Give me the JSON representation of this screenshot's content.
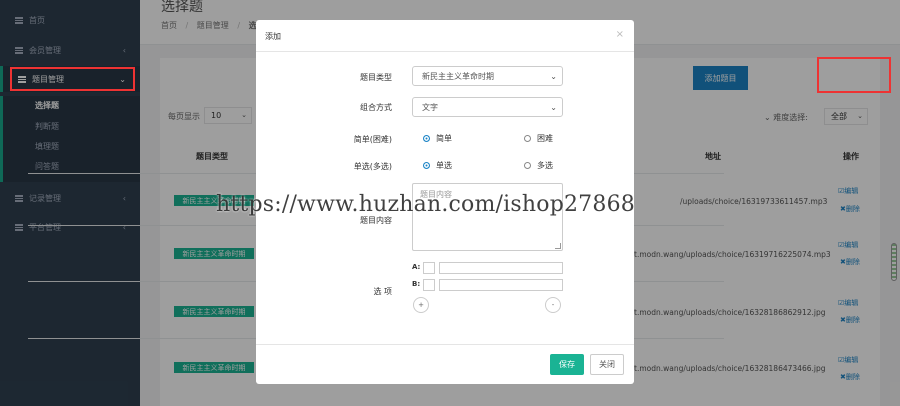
{
  "sidebar": {
    "items": [
      {
        "label": "首页"
      },
      {
        "label": "会员管理"
      },
      {
        "label": "题目管理"
      },
      {
        "label": "记录管理"
      },
      {
        "label": "平台管理"
      }
    ],
    "submenu": [
      "选择题",
      "判断题",
      "填理题",
      "问答题"
    ]
  },
  "header": {
    "title": "选择题",
    "breadcrumb": [
      "首页",
      "题目管理",
      "选"
    ]
  },
  "toolbar": {
    "page_size_label": "每页显示",
    "page_size_value": "10",
    "add_button": "添加题目",
    "difficulty_label": "难度选择:",
    "difficulty_value": "全部"
  },
  "table": {
    "columns": [
      "题目类型",
      "地址",
      "操作"
    ],
    "rows": [
      {
        "type": "新民主主义革命时期",
        "url": "/uploads/choice/16319733611457.mp3"
      },
      {
        "type": "新民主主义革命时期",
        "url": "t.modn.wang/uploads/choice/16319716225074.mp3"
      },
      {
        "type": "新民主主义革命时期",
        "url": "t.modn.wang/uploads/choice/16328186862912.jpg"
      },
      {
        "type": "新民主主义革命时期",
        "url": "t.modn.wang/uploads/choice/16328186473466.jpg"
      }
    ],
    "edit_label": "编辑",
    "delete_label": "删除"
  },
  "modal": {
    "title": "添加",
    "close_glyph": "×",
    "fields": {
      "type_label": "题目类型",
      "type_value": "新民主主义革命时期",
      "combo_label": "组合方式",
      "combo_value": "文字",
      "difficulty_label": "简单(困难)",
      "difficulty_opt1": "简单",
      "difficulty_opt2": "困难",
      "choice_label": "单选(多选)",
      "choice_opt1": "单选",
      "choice_opt2": "多选",
      "content_label": "题目内容",
      "content_placeholder": "题目内容",
      "options_label": "选 项",
      "option_a": "A:",
      "option_b": "B:",
      "add_glyph": "+",
      "remove_glyph": "-"
    },
    "save_button": "保存",
    "close_button": "关闭"
  },
  "watermark": "https://www.huzhan.com/ishop27868",
  "colors": {
    "sidebar_bg": "#2f4050",
    "accent_green": "#1ab394",
    "primary_blue": "#1c84c6",
    "highlight_red": "#e33333"
  }
}
